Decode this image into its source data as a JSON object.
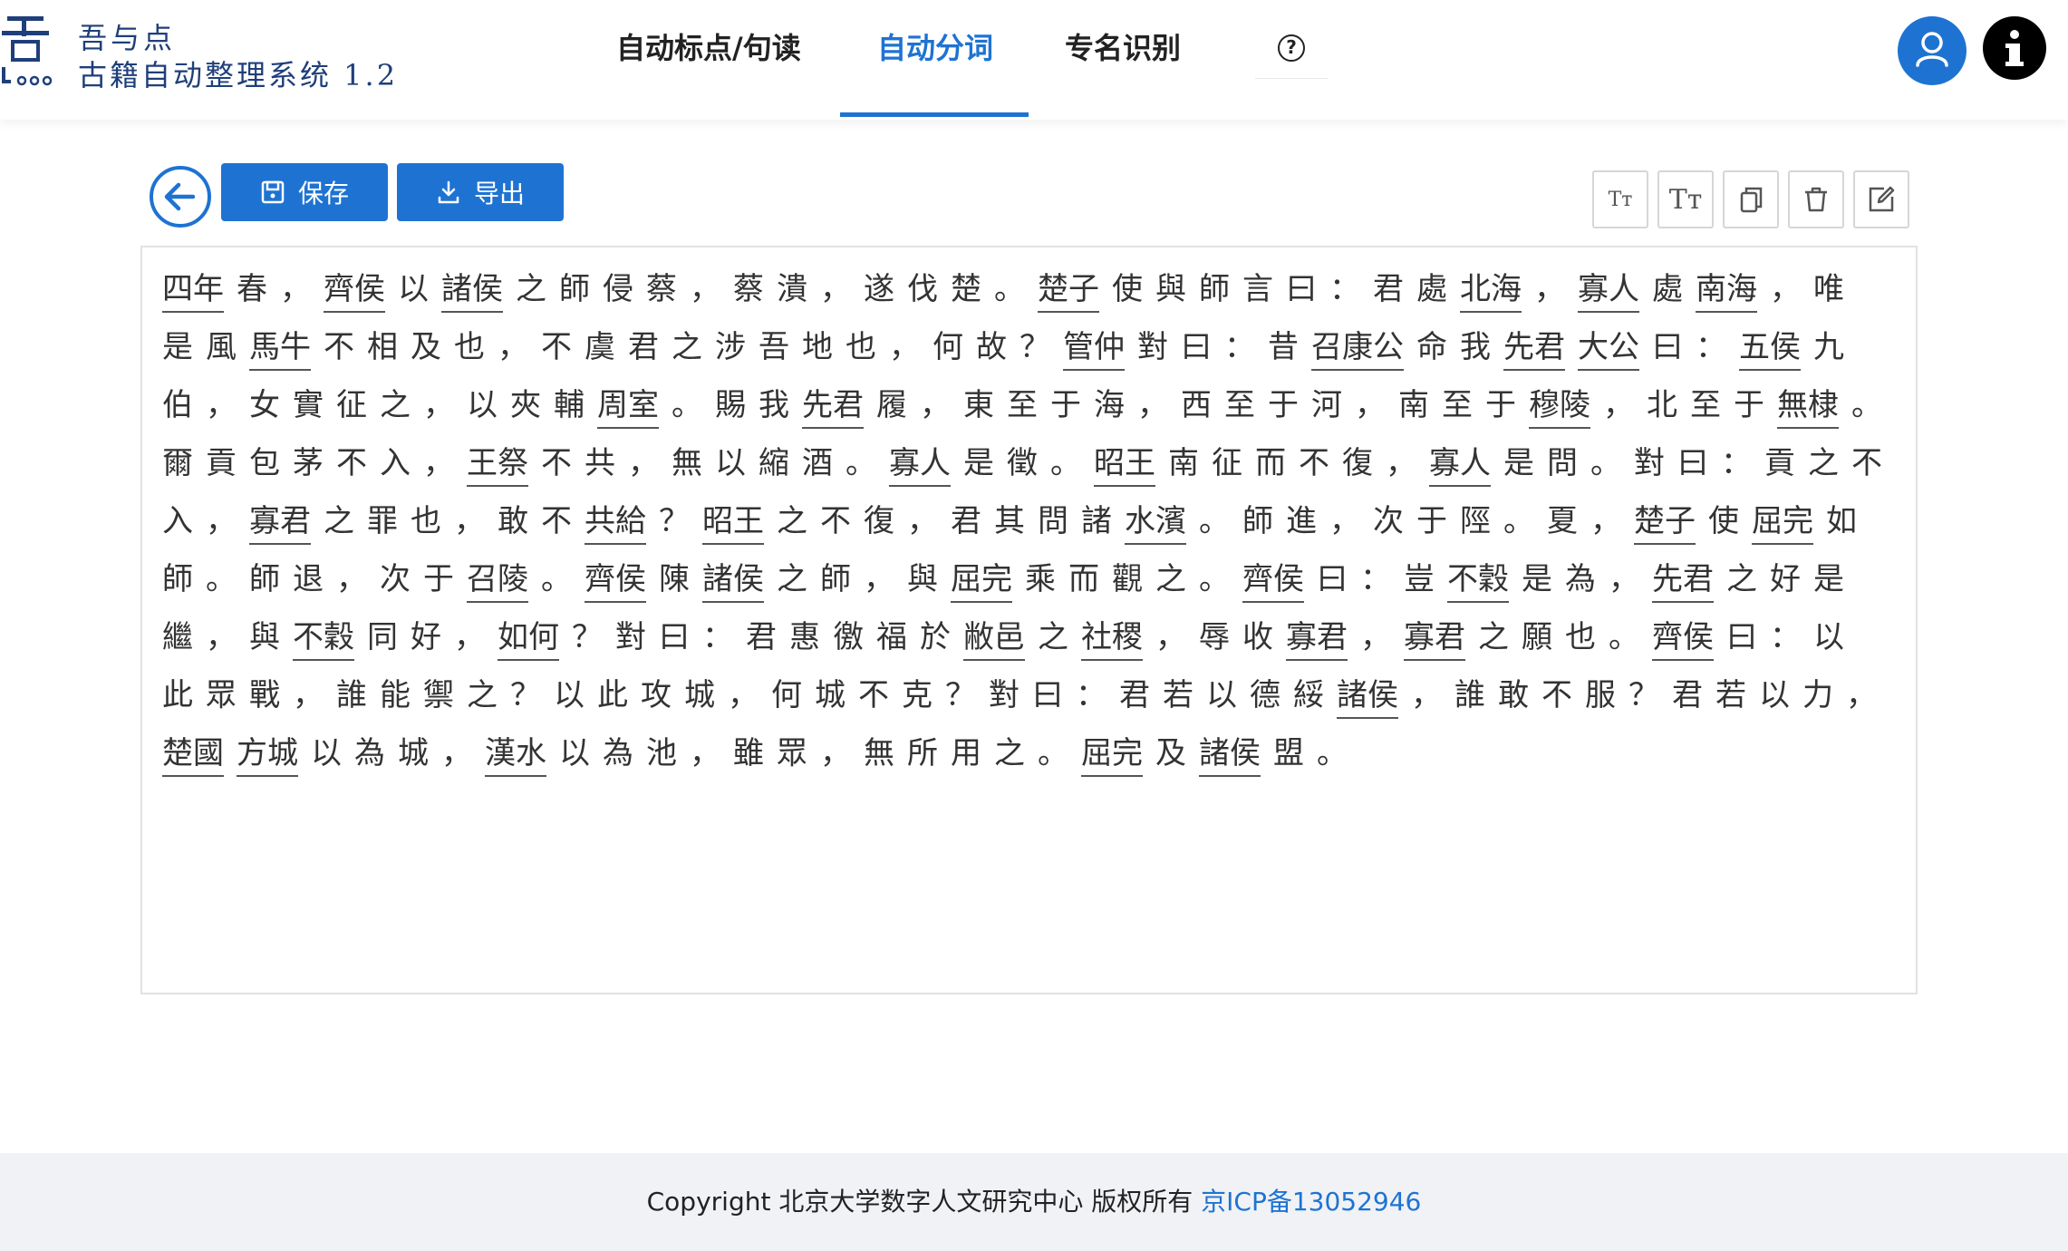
{
  "brand": {
    "name": "吾与点",
    "subtitle": "古籍自动整理系统 1.2"
  },
  "nav": {
    "items": [
      {
        "label": "自动标点/句读",
        "active": false
      },
      {
        "label": "自动分词",
        "active": true
      },
      {
        "label": "专名识别",
        "active": false
      }
    ],
    "help_label": "?"
  },
  "header_right": {
    "user_icon": "user-icon",
    "info_icon": "info-icon",
    "info_label": "i"
  },
  "toolbar": {
    "back_icon": "arrow-left-icon",
    "save_label": "保存",
    "export_label": "导出",
    "tools": [
      "font-decrease-icon",
      "font-increase-icon",
      "copy-icon",
      "delete-icon",
      "edit-icon"
    ],
    "tool_glyphs": [
      "Tт",
      "Tт"
    ]
  },
  "colors": {
    "accent": "#1e73d2",
    "text": "#333333",
    "footer_bg": "#f0f2f5"
  },
  "editor": {
    "lines": [
      [
        [
          "四年",
          1
        ],
        [
          "春",
          0
        ],
        [
          "，",
          0
        ],
        [
          "齊侯",
          1
        ],
        [
          "以",
          0
        ],
        [
          "諸侯",
          1
        ],
        [
          "之",
          0
        ],
        [
          "師",
          0
        ],
        [
          "侵",
          0
        ],
        [
          "蔡",
          0
        ],
        [
          "，",
          0
        ],
        [
          "蔡",
          0
        ],
        [
          "潰",
          0
        ],
        [
          "，",
          0
        ],
        [
          "遂",
          0
        ],
        [
          "伐",
          0
        ],
        [
          "楚",
          0
        ],
        [
          "。",
          0
        ],
        [
          "楚子",
          1
        ],
        [
          "使",
          0
        ],
        [
          "與",
          0
        ],
        [
          "師",
          0
        ],
        [
          "言",
          0
        ],
        [
          "曰",
          0
        ],
        [
          "：",
          0
        ],
        [
          "君",
          0
        ],
        [
          "處",
          0
        ],
        [
          "北海",
          1
        ],
        [
          "，",
          0
        ],
        [
          "寡人",
          1
        ],
        [
          "處",
          0
        ],
        [
          "南海",
          1
        ],
        [
          "，",
          0
        ],
        [
          "唯",
          0
        ]
      ],
      [
        [
          "是",
          0
        ],
        [
          "風",
          0
        ],
        [
          "馬牛",
          1
        ],
        [
          "不",
          0
        ],
        [
          "相",
          0
        ],
        [
          "及",
          0
        ],
        [
          "也",
          0
        ],
        [
          "，",
          0
        ],
        [
          "不",
          0
        ],
        [
          "虞",
          0
        ],
        [
          "君",
          0
        ],
        [
          "之",
          0
        ],
        [
          "涉",
          0
        ],
        [
          "吾",
          0
        ],
        [
          "地",
          0
        ],
        [
          "也",
          0
        ],
        [
          "，",
          0
        ],
        [
          "何",
          0
        ],
        [
          "故",
          0
        ],
        [
          "？",
          0
        ],
        [
          "管仲",
          1
        ],
        [
          "對",
          0
        ],
        [
          "曰",
          0
        ],
        [
          "：",
          0
        ],
        [
          "昔",
          0
        ],
        [
          "召康公",
          1
        ],
        [
          "命",
          0
        ],
        [
          "我",
          0
        ],
        [
          "先君",
          1
        ],
        [
          "大公",
          1
        ],
        [
          "曰",
          0
        ],
        [
          "：",
          0
        ],
        [
          "五侯",
          1
        ],
        [
          "九",
          0
        ]
      ],
      [
        [
          "伯",
          0
        ],
        [
          "，",
          0
        ],
        [
          "女",
          0
        ],
        [
          "實",
          0
        ],
        [
          "征",
          0
        ],
        [
          "之",
          0
        ],
        [
          "，",
          0
        ],
        [
          "以",
          0
        ],
        [
          "夾",
          0
        ],
        [
          "輔",
          0
        ],
        [
          "周室",
          1
        ],
        [
          "。",
          0
        ],
        [
          "賜",
          0
        ],
        [
          "我",
          0
        ],
        [
          "先君",
          1
        ],
        [
          "履",
          0
        ],
        [
          "，",
          0
        ],
        [
          "東",
          0
        ],
        [
          "至",
          0
        ],
        [
          "于",
          0
        ],
        [
          "海",
          0
        ],
        [
          "，",
          0
        ],
        [
          "西",
          0
        ],
        [
          "至",
          0
        ],
        [
          "于",
          0
        ],
        [
          "河",
          0
        ],
        [
          "，",
          0
        ],
        [
          "南",
          0
        ],
        [
          "至",
          0
        ],
        [
          "于",
          0
        ],
        [
          "穆陵",
          1
        ],
        [
          "，",
          0
        ],
        [
          "北",
          0
        ],
        [
          "至",
          0
        ],
        [
          "于",
          0
        ],
        [
          "無棣",
          1
        ],
        [
          "。",
          0
        ]
      ],
      [
        [
          "爾",
          0
        ],
        [
          "貢",
          0
        ],
        [
          "包",
          0
        ],
        [
          "茅",
          0
        ],
        [
          "不",
          0
        ],
        [
          "入",
          0
        ],
        [
          "，",
          0
        ],
        [
          "王祭",
          1
        ],
        [
          "不",
          0
        ],
        [
          "共",
          0
        ],
        [
          "，",
          0
        ],
        [
          "無",
          0
        ],
        [
          "以",
          0
        ],
        [
          "縮",
          0
        ],
        [
          "酒",
          0
        ],
        [
          "。",
          0
        ],
        [
          "寡人",
          1
        ],
        [
          "是",
          0
        ],
        [
          "徵",
          0
        ],
        [
          "。",
          0
        ],
        [
          "昭王",
          1
        ],
        [
          "南",
          0
        ],
        [
          "征",
          0
        ],
        [
          "而",
          0
        ],
        [
          "不",
          0
        ],
        [
          "復",
          0
        ],
        [
          "，",
          0
        ],
        [
          "寡人",
          1
        ],
        [
          "是",
          0
        ],
        [
          "問",
          0
        ],
        [
          "。",
          0
        ],
        [
          "對",
          0
        ],
        [
          "曰",
          0
        ],
        [
          "：",
          0
        ],
        [
          "貢",
          0
        ],
        [
          "之",
          0
        ],
        [
          "不",
          0
        ]
      ],
      [
        [
          "入",
          0
        ],
        [
          "，",
          0
        ],
        [
          "寡君",
          1
        ],
        [
          "之",
          0
        ],
        [
          "罪",
          0
        ],
        [
          "也",
          0
        ],
        [
          "，",
          0
        ],
        [
          "敢",
          0
        ],
        [
          "不",
          0
        ],
        [
          "共給",
          1
        ],
        [
          "？",
          0
        ],
        [
          "昭王",
          1
        ],
        [
          "之",
          0
        ],
        [
          "不",
          0
        ],
        [
          "復",
          0
        ],
        [
          "，",
          0
        ],
        [
          "君",
          0
        ],
        [
          "其",
          0
        ],
        [
          "問",
          0
        ],
        [
          "諸",
          0
        ],
        [
          "水濱",
          1
        ],
        [
          "。",
          0
        ],
        [
          "師",
          0
        ],
        [
          "進",
          0
        ],
        [
          "，",
          0
        ],
        [
          "次",
          0
        ],
        [
          "于",
          0
        ],
        [
          "陘",
          0
        ],
        [
          "。",
          0
        ],
        [
          "夏",
          0
        ],
        [
          "，",
          0
        ],
        [
          "楚子",
          1
        ],
        [
          "使",
          0
        ],
        [
          "屈完",
          1
        ],
        [
          "如",
          0
        ]
      ],
      [
        [
          "師",
          0
        ],
        [
          "。",
          0
        ],
        [
          "師",
          0
        ],
        [
          "退",
          0
        ],
        [
          "，",
          0
        ],
        [
          "次",
          0
        ],
        [
          "于",
          0
        ],
        [
          "召陵",
          1
        ],
        [
          "。",
          0
        ],
        [
          "齊侯",
          1
        ],
        [
          "陳",
          0
        ],
        [
          "諸侯",
          1
        ],
        [
          "之",
          0
        ],
        [
          "師",
          0
        ],
        [
          "，",
          0
        ],
        [
          "與",
          0
        ],
        [
          "屈完",
          1
        ],
        [
          "乘",
          0
        ],
        [
          "而",
          0
        ],
        [
          "觀",
          0
        ],
        [
          "之",
          0
        ],
        [
          "。",
          0
        ],
        [
          "齊侯",
          1
        ],
        [
          "曰",
          0
        ],
        [
          "：",
          0
        ],
        [
          "豈",
          0
        ],
        [
          "不穀",
          1
        ],
        [
          "是",
          0
        ],
        [
          "為",
          0
        ],
        [
          "，",
          0
        ],
        [
          "先君",
          1
        ],
        [
          "之",
          0
        ],
        [
          "好",
          0
        ],
        [
          "是",
          0
        ]
      ],
      [
        [
          "繼",
          0
        ],
        [
          "，",
          0
        ],
        [
          "與",
          0
        ],
        [
          "不穀",
          1
        ],
        [
          "同",
          0
        ],
        [
          "好",
          0
        ],
        [
          "，",
          0
        ],
        [
          "如何",
          1
        ],
        [
          "？",
          0
        ],
        [
          "對",
          0
        ],
        [
          "曰",
          0
        ],
        [
          "：",
          0
        ],
        [
          "君",
          0
        ],
        [
          "惠",
          0
        ],
        [
          "徼",
          0
        ],
        [
          "福",
          0
        ],
        [
          "於",
          0
        ],
        [
          "敝邑",
          1
        ],
        [
          "之",
          0
        ],
        [
          "社稷",
          1
        ],
        [
          "，",
          0
        ],
        [
          "辱",
          0
        ],
        [
          "收",
          0
        ],
        [
          "寡君",
          1
        ],
        [
          "，",
          0
        ],
        [
          "寡君",
          1
        ],
        [
          "之",
          0
        ],
        [
          "願",
          0
        ],
        [
          "也",
          0
        ],
        [
          "。",
          0
        ],
        [
          "齊侯",
          1
        ],
        [
          "曰",
          0
        ],
        [
          "：",
          0
        ],
        [
          "以",
          0
        ]
      ],
      [
        [
          "此",
          0
        ],
        [
          "眾",
          0
        ],
        [
          "戰",
          0
        ],
        [
          "，",
          0
        ],
        [
          "誰",
          0
        ],
        [
          "能",
          0
        ],
        [
          "禦",
          0
        ],
        [
          "之",
          0
        ],
        [
          "？",
          0
        ],
        [
          "以",
          0
        ],
        [
          "此",
          0
        ],
        [
          "攻",
          0
        ],
        [
          "城",
          0
        ],
        [
          "，",
          0
        ],
        [
          "何",
          0
        ],
        [
          "城",
          0
        ],
        [
          "不",
          0
        ],
        [
          "克",
          0
        ],
        [
          "？",
          0
        ],
        [
          "對",
          0
        ],
        [
          "曰",
          0
        ],
        [
          "：",
          0
        ],
        [
          "君",
          0
        ],
        [
          "若",
          0
        ],
        [
          "以",
          0
        ],
        [
          "德",
          0
        ],
        [
          "綏",
          0
        ],
        [
          "諸侯",
          1
        ],
        [
          "，",
          0
        ],
        [
          "誰",
          0
        ],
        [
          "敢",
          0
        ],
        [
          "不",
          0
        ],
        [
          "服",
          0
        ],
        [
          "？",
          0
        ],
        [
          "君",
          0
        ],
        [
          "若",
          0
        ],
        [
          "以",
          0
        ],
        [
          "力",
          0
        ],
        [
          "，",
          0
        ]
      ],
      [
        [
          "楚國",
          1
        ],
        [
          "方城",
          1
        ],
        [
          "以",
          0
        ],
        [
          "為",
          0
        ],
        [
          "城",
          0
        ],
        [
          "，",
          0
        ],
        [
          "漢水",
          1
        ],
        [
          "以",
          0
        ],
        [
          "為",
          0
        ],
        [
          "池",
          0
        ],
        [
          "，",
          0
        ],
        [
          "雖",
          0
        ],
        [
          "眾",
          0
        ],
        [
          "，",
          0
        ],
        [
          "無",
          0
        ],
        [
          "所",
          0
        ],
        [
          "用",
          0
        ],
        [
          "之",
          0
        ],
        [
          "。",
          0
        ],
        [
          "屈完",
          1
        ],
        [
          "及",
          0
        ],
        [
          "諸侯",
          1
        ],
        [
          "盟",
          0
        ],
        [
          "。",
          0
        ]
      ]
    ]
  },
  "footer": {
    "copyright": "Copyright 北京大学数字人文研究中心 版权所有",
    "icp": "京ICP备13052946"
  }
}
